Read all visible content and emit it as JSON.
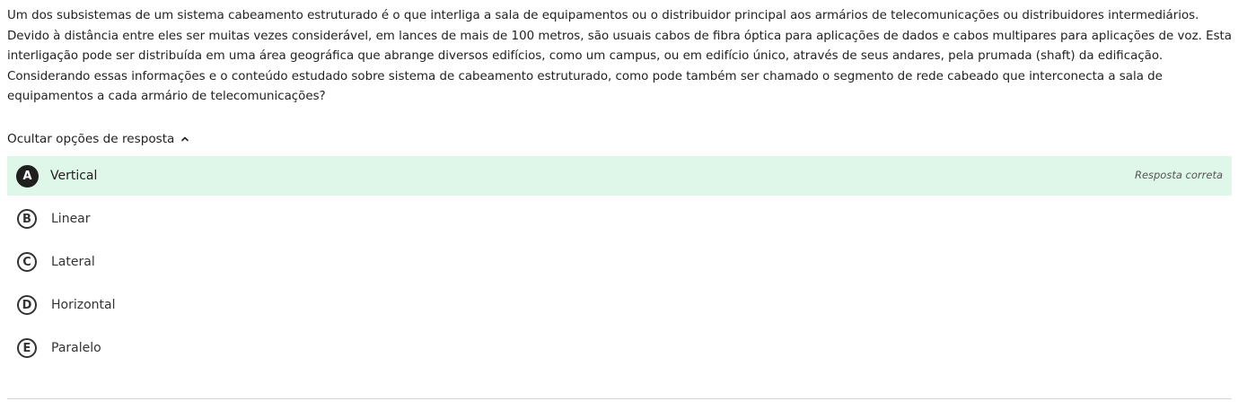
{
  "question": {
    "lines": [
      "Um dos subsistemas de um sistema cabeamento estruturado é o que interliga a sala de equipamentos ou o distribuidor principal aos armários de telecomunicações ou distribuidores intermediários.",
      "Devido à distância entre eles ser muitas vezes considerável, em lances de mais de 100 metros, são usuais cabos de fibra óptica para aplicações de dados e cabos multipares para aplicações de voz. Esta",
      "interligação pode ser distribuída em uma área geográfica que abrange diversos edifícios, como um campus, ou em edifício único, através de seus andares, pela prumada (shaft) da edificação.",
      "Considerando essas informações e o conteúdo estudado sobre sistema de cabeamento estruturado, como pode também ser chamado o segmento de rede cabeado que interconecta a sala de",
      "equipamentos a cada armário de telecomunicações?"
    ]
  },
  "toggle": {
    "label": "Ocultar opções de resposta",
    "icon": "chevron-up-icon"
  },
  "options": [
    {
      "letter": "A",
      "text": "Vertical",
      "correct": true,
      "tag": "Resposta correta"
    },
    {
      "letter": "B",
      "text": "Linear",
      "correct": false
    },
    {
      "letter": "C",
      "text": "Lateral",
      "correct": false
    },
    {
      "letter": "D",
      "text": "Horizontal",
      "correct": false
    },
    {
      "letter": "E",
      "text": "Paralelo",
      "correct": false
    }
  ],
  "colors": {
    "correct_bg": "#dff7e9",
    "badge_selected": "#1f1f1f",
    "text": "#212121",
    "divider": "#d6d6d6"
  }
}
